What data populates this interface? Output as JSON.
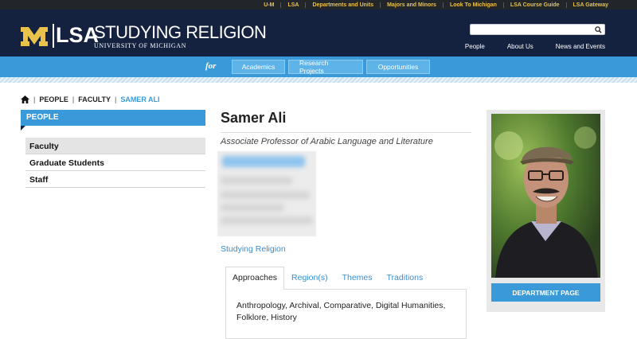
{
  "utility_nav": [
    "U-M",
    "LSA",
    "Departments and Units",
    "Majors and Minors",
    "Look To Michigan",
    "LSA Course Guide",
    "LSA Gateway"
  ],
  "header": {
    "logo_lsa": "LSA",
    "site_title": "STUDYING RELIGION",
    "site_subtitle": "UNIVERSITY OF MICHIGAN",
    "search_placeholder": "",
    "nav": [
      "People",
      "About Us",
      "News and Events"
    ]
  },
  "subnav": {
    "for_label": "for",
    "tabs": [
      "Academics",
      "Research Projects",
      "Opportunities"
    ]
  },
  "breadcrumb": {
    "items": [
      "PEOPLE",
      "FACULTY"
    ],
    "current": "SAMER ALI"
  },
  "sidebar": {
    "header": "PEOPLE",
    "items": [
      "Faculty",
      "Graduate Students",
      "Staff"
    ],
    "active_index": 0
  },
  "profile": {
    "name": "Samer Ali",
    "title": "Associate Professor of Arabic Language and Literature",
    "department_link": "Studying Religion",
    "tabs": [
      "Approaches",
      "Region(s)",
      "Themes",
      "Traditions"
    ],
    "active_tab": 0,
    "approaches_text": "Anthropology, Archival, Comparative, Digital Humanities, Folklore, History",
    "department_button": "DEPARTMENT PAGE"
  },
  "colors": {
    "brand_navy": "#14213f",
    "accent_blue": "#3a9ad9",
    "maize": "#e8c24a"
  }
}
